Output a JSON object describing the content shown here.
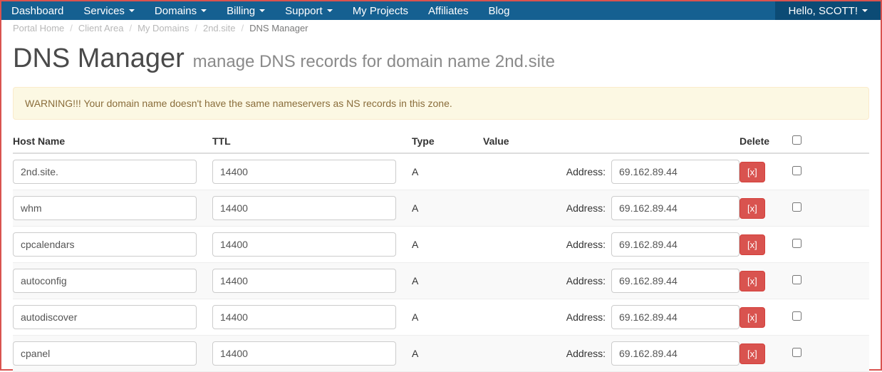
{
  "nav": {
    "items": [
      {
        "label": "Dashboard",
        "caret": false
      },
      {
        "label": "Services",
        "caret": true
      },
      {
        "label": "Domains",
        "caret": true
      },
      {
        "label": "Billing",
        "caret": true
      },
      {
        "label": "Support",
        "caret": true
      },
      {
        "label": "My Projects",
        "caret": false
      },
      {
        "label": "Affiliates",
        "caret": false
      },
      {
        "label": "Blog",
        "caret": false
      }
    ],
    "user_greeting": "Hello, SCOTT!"
  },
  "breadcrumb": [
    {
      "label": "Portal Home"
    },
    {
      "label": "Client Area"
    },
    {
      "label": "My Domains"
    },
    {
      "label": "2nd.site"
    },
    {
      "label": "DNS Manager",
      "active": true
    }
  ],
  "page": {
    "title": "DNS Manager",
    "subtitle": "manage DNS records for domain name 2nd.site"
  },
  "alert": "WARNING!!! Your domain name doesn't have the same nameservers as NS records in this zone.",
  "table": {
    "headers": {
      "host": "Host Name",
      "ttl": "TTL",
      "type": "Type",
      "value": "Value",
      "delete": "Delete"
    },
    "address_label": "Address:",
    "delete_button": "[x]",
    "rows": [
      {
        "host": "2nd.site.",
        "ttl": "14400",
        "type": "A",
        "address": "69.162.89.44"
      },
      {
        "host": "whm",
        "ttl": "14400",
        "type": "A",
        "address": "69.162.89.44"
      },
      {
        "host": "cpcalendars",
        "ttl": "14400",
        "type": "A",
        "address": "69.162.89.44"
      },
      {
        "host": "autoconfig",
        "ttl": "14400",
        "type": "A",
        "address": "69.162.89.44"
      },
      {
        "host": "autodiscover",
        "ttl": "14400",
        "type": "A",
        "address": "69.162.89.44"
      },
      {
        "host": "cpanel",
        "ttl": "14400",
        "type": "A",
        "address": "69.162.89.44"
      }
    ]
  }
}
